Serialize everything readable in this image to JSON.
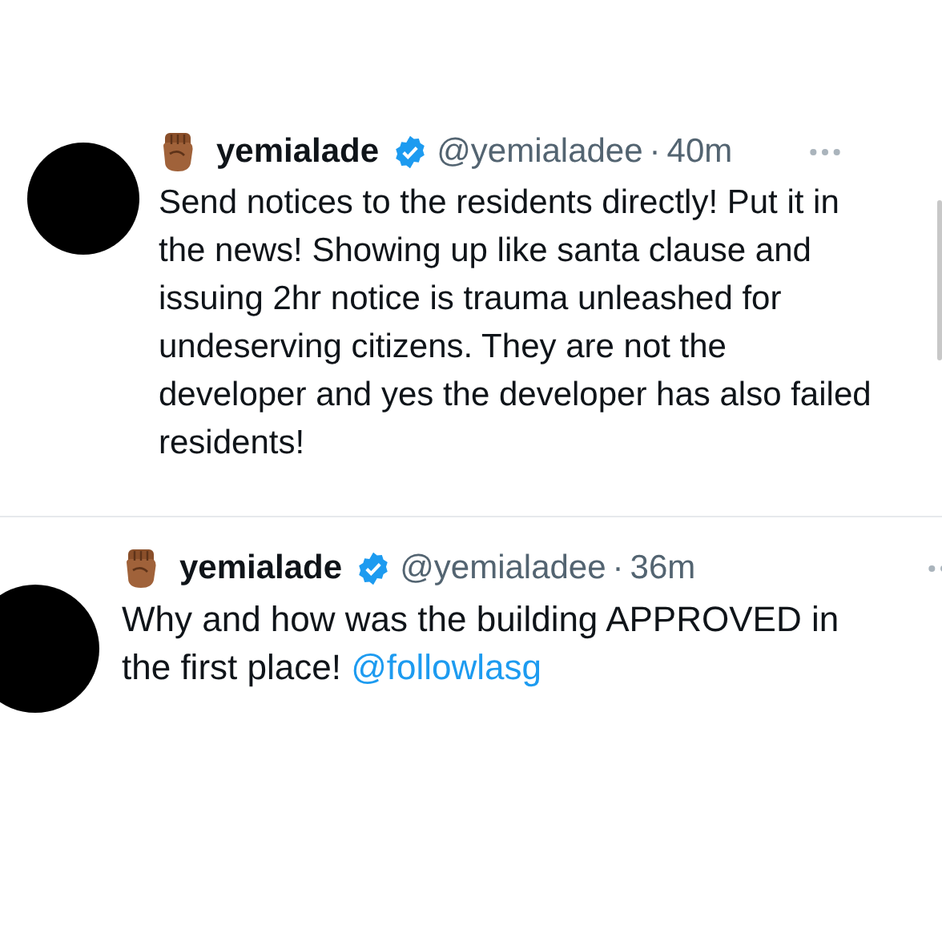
{
  "tweets": [
    {
      "name": "yemialade",
      "verified": true,
      "handle": "@yemialadee",
      "separator": "·",
      "time": "40m",
      "body": [
        {
          "kind": "text",
          "text": "Send notices to the residents directly! Put it in the news! Showing up like santa clause and issuing 2hr notice is trauma unleashed for undeserving citizens. They are not the developer and yes the developer has also failed residents!"
        }
      ]
    },
    {
      "name": "yemialade",
      "verified": true,
      "handle": "@yemialadee",
      "separator": "·",
      "time": "36m",
      "body": [
        {
          "kind": "text",
          "text": "Why and how was the building APPROVED in the first place! "
        },
        {
          "kind": "mention",
          "text": "@followlasg"
        }
      ]
    }
  ]
}
